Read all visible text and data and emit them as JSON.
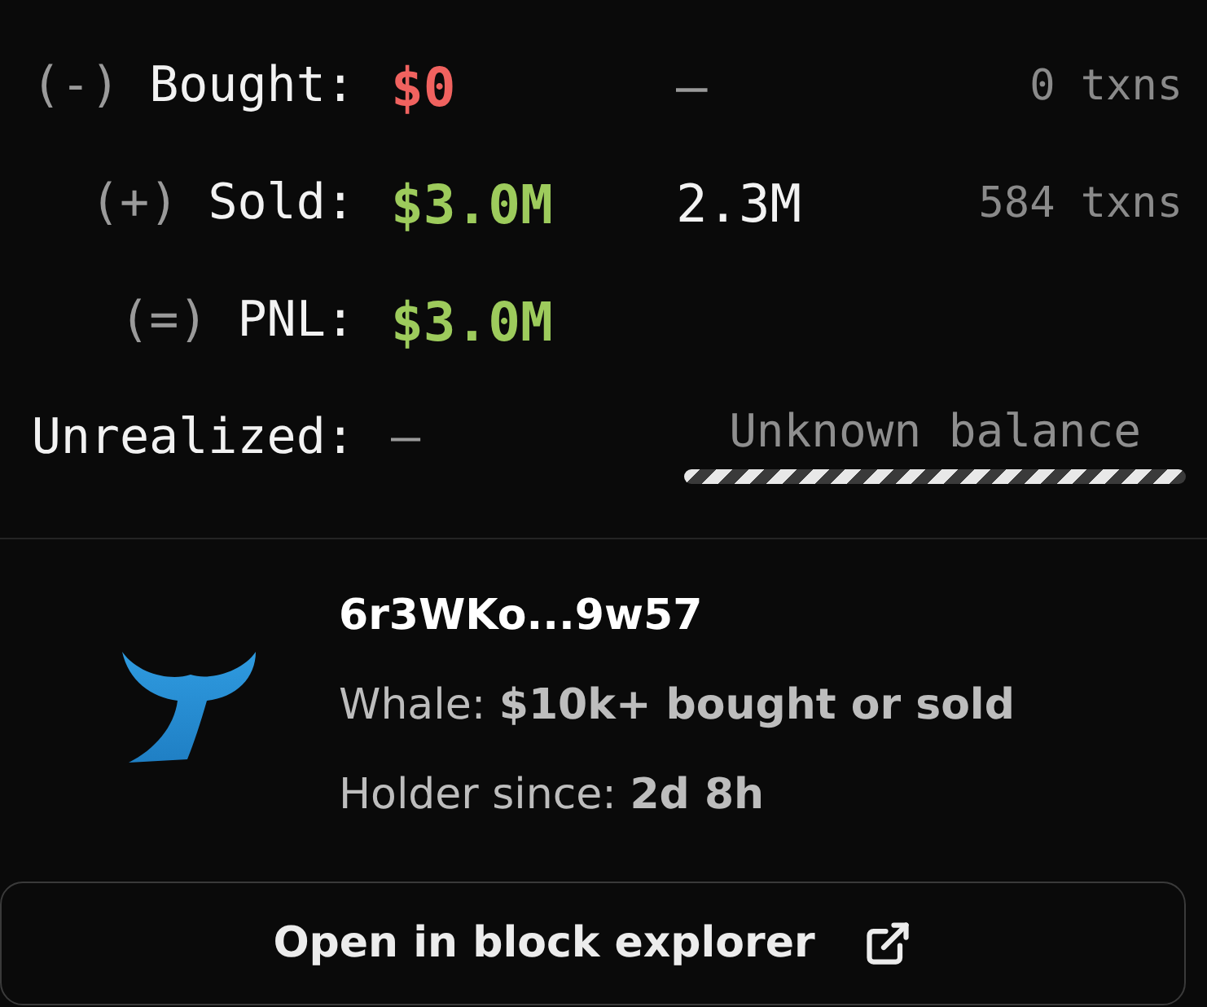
{
  "flows": [
    {
      "sign": "(-)",
      "label": "Bought:",
      "value": "$0",
      "color": "#f0625f",
      "amount": "–",
      "txns": "0 txns"
    },
    {
      "sign": "(+)",
      "label": "Sold:",
      "value": "$3.0M",
      "color": "#9dcb5c",
      "amount": "2.3M",
      "txns": "584 txns"
    },
    {
      "sign": "(=)",
      "label": "PNL:",
      "value": "$3.0M",
      "color": "#9dcb5c"
    }
  ],
  "unrealized": {
    "label": "Unrealized:",
    "value": "–",
    "balance": "Unknown balance"
  },
  "wallet": {
    "address": "6r3WKo...9w57",
    "lines": [
      "Whale: **$10k+ bought or sold**",
      "Holder since: **2d 8h**"
    ]
  },
  "button": {
    "label": "Open in block explorer"
  }
}
